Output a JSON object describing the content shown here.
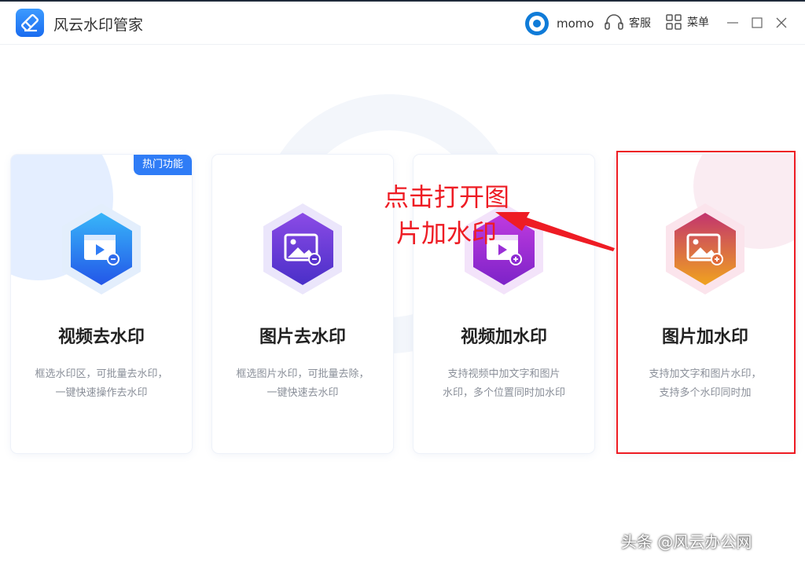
{
  "app": {
    "title": "风云水印管家"
  },
  "header": {
    "username": "momo",
    "service_label": "客服",
    "menu_label": "菜单"
  },
  "cards": [
    {
      "title": "视频去水印",
      "desc_line1": "框选水印区，可批量去水印，",
      "desc_line2": "一键快速操作去水印",
      "badge": "热门功能",
      "icon": "video-remove-icon"
    },
    {
      "title": "图片去水印",
      "desc_line1": "框选图片水印，可批量去除，",
      "desc_line2": "一键快速去水印",
      "icon": "image-remove-icon"
    },
    {
      "title": "视频加水印",
      "desc_line1": "支持视频中加文字和图片",
      "desc_line2": "水印，多个位置同时加水印",
      "icon": "video-add-icon"
    },
    {
      "title": "图片加水印",
      "desc_line1": "支持加文字和图片水印，",
      "desc_line2": "支持多个水印同时加",
      "icon": "image-add-icon"
    }
  ],
  "annotation": {
    "line1": "点击打开图",
    "line2": "片加水印"
  },
  "watermark": "头条 @风云办公网",
  "colors": {
    "accent_blue": "#2f7cf6",
    "annotation_red": "#ee1c24"
  }
}
